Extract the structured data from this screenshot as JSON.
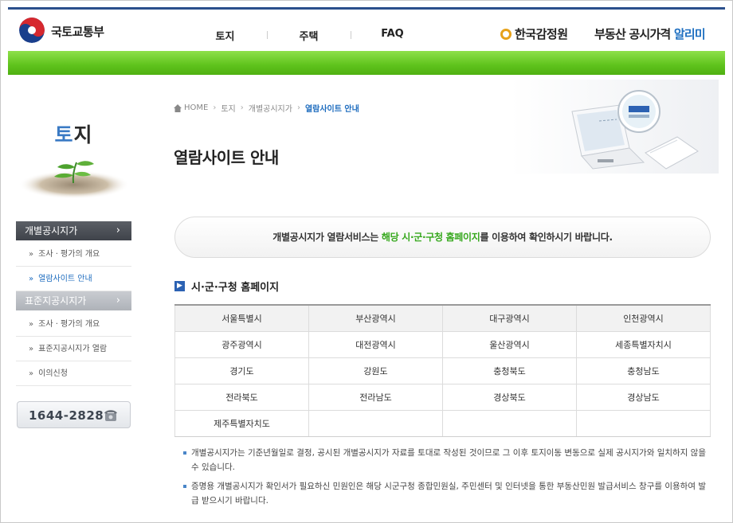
{
  "header": {
    "ministry": "국토교통부",
    "nav": [
      "토지",
      "주택",
      "FAQ"
    ],
    "agency": "한국감정원",
    "service_prefix": "부동산 공시가격 ",
    "service_accent": "알리미"
  },
  "sidebar": {
    "title_first": "토",
    "title_rest": "지",
    "menus": [
      {
        "label": "개별공시지가",
        "chevron": "›",
        "items": [
          "조사 · 평가의 개요",
          "열람사이트 안내"
        ]
      },
      {
        "label": "표준지공시지가",
        "chevron": "›",
        "items": [
          "조사 · 평가의 개요",
          "표준지공시지가 열람",
          "이의신청"
        ]
      }
    ],
    "phone": "1644-2828"
  },
  "breadcrumb": {
    "home": "HOME",
    "sep": "›",
    "items": [
      "토지",
      "개별공시지가"
    ],
    "current": "열람사이트 안내"
  },
  "page_title": "열람사이트 안내",
  "notice": {
    "before": "개별공시지가 열람서비스는 ",
    "highlight": "해당 시·군·구청 홈페이지",
    "after": "를 이용하여 확인하시기 바랍니다."
  },
  "section_title": "시·군·구청 홈페이지",
  "cities": [
    [
      "서울특별시",
      "부산광역시",
      "대구광역시",
      "인천광역시"
    ],
    [
      "광주광역시",
      "대전광역시",
      "울산광역시",
      "세종특별자치시"
    ],
    [
      "경기도",
      "강원도",
      "충청북도",
      "충청남도"
    ],
    [
      "전라북도",
      "전라남도",
      "경상북도",
      "경상남도"
    ],
    [
      "제주특별자치도",
      "",
      "",
      ""
    ]
  ],
  "notes": [
    "개별공시지가는 기준년월일로 결정, 공시된 개별공시지가 자료를 토대로 작성된 것이므로 그 이후 토지이동 변동으로 실제 공시지가와 일치하지 않을 수 있습니다.",
    "증명용 개별공시지가 확인서가 필요하신 민원인은 해당 시군구청 종합민원실, 주민센터 및 인터넷을 통한 부동산민원 발급서비스 창구를 이용하여 발급 받으시기 바랍니다."
  ],
  "colors": {
    "accent_blue": "#1f6dbf",
    "green_bar": "#5fc31c",
    "highlight_green": "#36a81d"
  }
}
